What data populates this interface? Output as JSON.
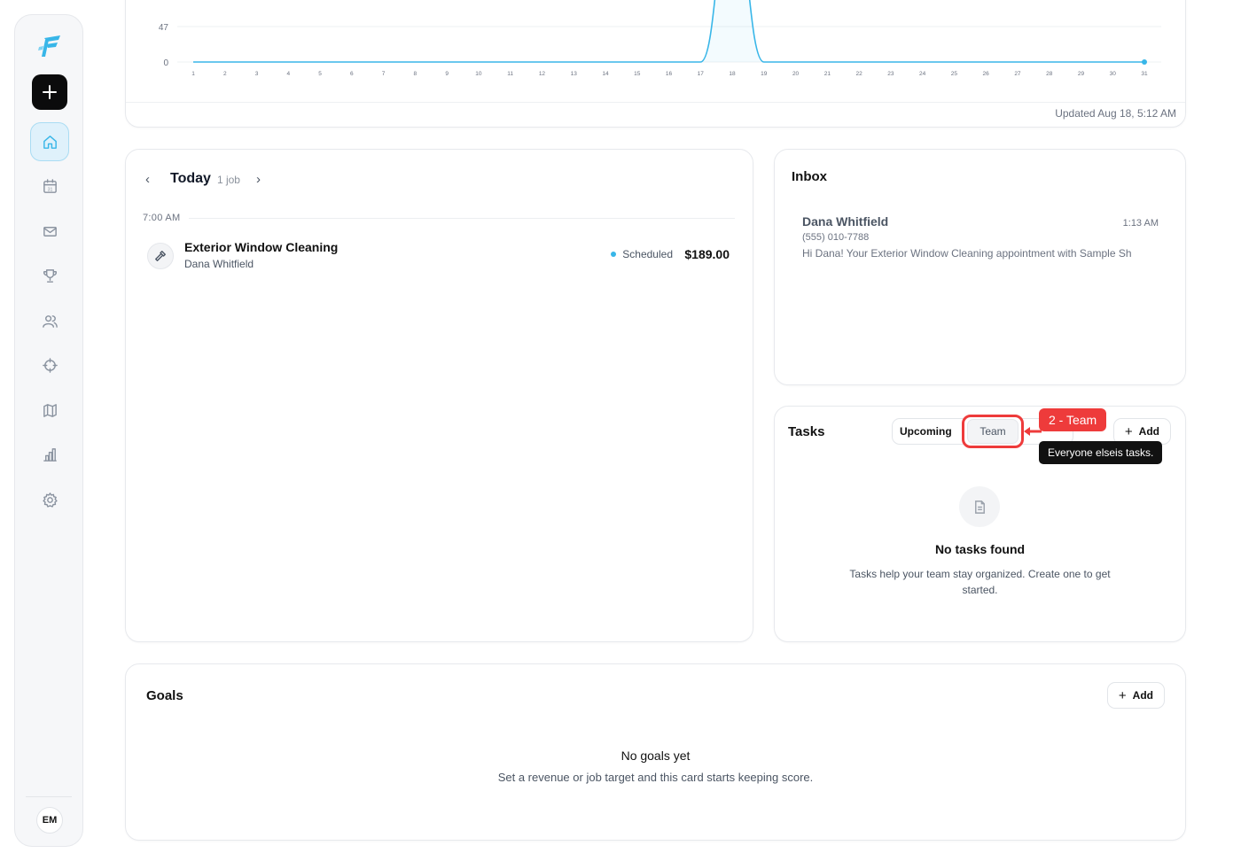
{
  "app": {
    "accent": "#38b6e8",
    "avatar_initials": "EM"
  },
  "sidebar": {
    "items": [
      {
        "icon": "home-icon",
        "active": true
      },
      {
        "icon": "calendar-icon",
        "calendar_day": "31",
        "active": false
      },
      {
        "icon": "mail-icon",
        "active": false
      },
      {
        "icon": "trophy-icon",
        "active": false
      },
      {
        "icon": "users-icon",
        "active": false
      },
      {
        "icon": "crosshair-icon",
        "active": false
      },
      {
        "icon": "map-icon",
        "active": false
      },
      {
        "icon": "bar-chart-icon",
        "active": false
      },
      {
        "icon": "settings-icon",
        "active": false
      }
    ]
  },
  "chart_data": {
    "type": "area",
    "x_tick_labels": [
      "1",
      "2",
      "3",
      "4",
      "5",
      "6",
      "7",
      "8",
      "9",
      "10",
      "11",
      "12",
      "13",
      "14",
      "15",
      "16",
      "17",
      "18",
      "19",
      "20",
      "21",
      "22",
      "23",
      "24",
      "25",
      "26",
      "27",
      "28",
      "29",
      "30",
      "31"
    ],
    "y_tick_labels": [
      "0",
      "47"
    ],
    "series": [
      {
        "x": [
          1,
          2,
          3,
          4,
          5,
          6,
          7,
          8,
          9,
          10,
          11,
          12,
          13,
          14,
          15,
          16,
          17,
          18,
          19,
          20,
          21,
          22,
          23,
          24,
          25,
          26,
          27,
          28,
          29,
          30,
          31
        ],
        "values": [
          0,
          0,
          0,
          0,
          0,
          0,
          0,
          0,
          0,
          0,
          0,
          0,
          0,
          0,
          0,
          0,
          0,
          189,
          0,
          0,
          0,
          0,
          0,
          0,
          0,
          0,
          0,
          0,
          0,
          0,
          0
        ],
        "color": "#38b6e8"
      }
    ],
    "ylim": [
      0,
      189
    ],
    "grid": true,
    "updated_text": "Updated Aug 18, 5:12 AM"
  },
  "schedule": {
    "title": "Today",
    "job_count": "1 job",
    "time_slot": "7:00 AM",
    "jobs": [
      {
        "title": "Exterior Window Cleaning",
        "client": "Dana Whitfield",
        "status": "Scheduled",
        "price": "$189.00"
      }
    ]
  },
  "inbox": {
    "title": "Inbox",
    "messages": [
      {
        "name": "Dana Whitfield",
        "time": "1:13 AM",
        "phone": "(555) 010-7788",
        "preview": "Hi Dana! Your Exterior Window Cleaning appointment with Sample Sh"
      }
    ]
  },
  "tasks": {
    "title": "Tasks",
    "tabs": [
      "Upcoming",
      "Team"
    ],
    "add_label": "Add",
    "annotation_badge": "2 - Team",
    "tooltip": "Everyone elseis tasks.",
    "empty_title": "No tasks found",
    "empty_desc": "Tasks help your team stay organized. Create one to get started."
  },
  "goals": {
    "title": "Goals",
    "add_label": "Add",
    "empty_title": "No goals yet",
    "empty_desc": "Set a revenue or job target and this card starts keeping score."
  }
}
